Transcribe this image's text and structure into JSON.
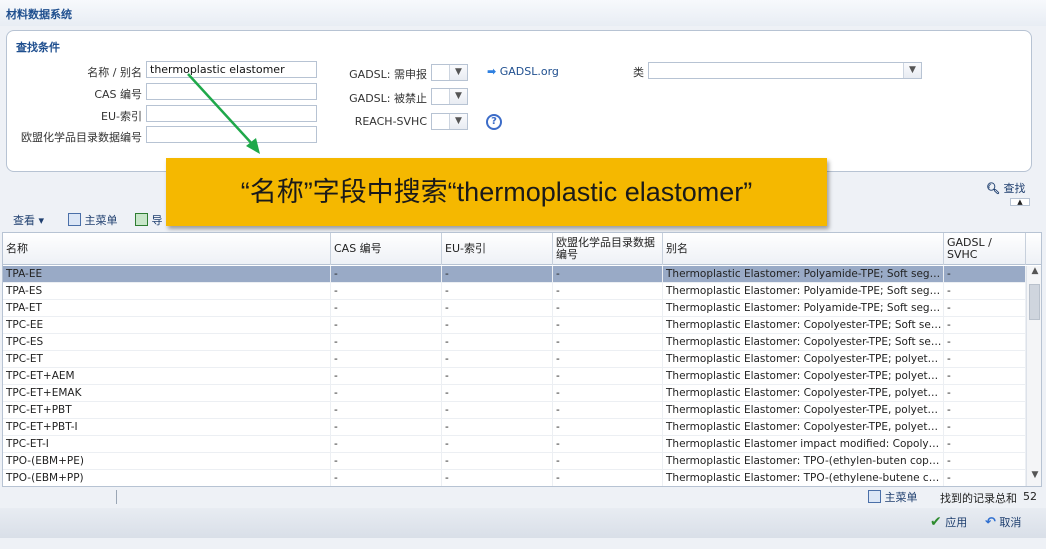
{
  "window": {
    "title": "材料数据系统"
  },
  "search": {
    "header": "查找条件",
    "name_label": "名称 / 别名",
    "name_value": "thermoplastic elastomer",
    "cas_label": "CAS 编号",
    "eu_label": "EU-索引",
    "eci_label": "欧盟化学品目录数据编号",
    "gadsl_declare_label": "GADSL: 需申报",
    "gadsl_forbid_label": "GADSL: 被禁止",
    "reach_label": "REACH-SVHC",
    "gadsl_link": "GADSL.org",
    "class_label": "类",
    "help_icon": "?",
    "find_label": "查找"
  },
  "callout": {
    "text": "“名称”字段中搜索“thermoplastic elastomer”"
  },
  "toolbar": {
    "view_label": "查看 ▾",
    "main_menu_label": "主菜单",
    "export_label": "导"
  },
  "grid": {
    "headers": [
      "名称",
      "CAS 编号",
      "EU-索引",
      "欧盟化学品目录数据编号",
      "别名",
      "GADSL / SVHC"
    ],
    "rows": [
      [
        "TPA-EE",
        "-",
        "-",
        "-",
        "Thermoplastic Elastomer: Polyamide-TPE; Soft segment...",
        "-"
      ],
      [
        "TPA-ES",
        "-",
        "-",
        "-",
        "Thermoplastic Elastomer: Polyamide-TPE; Soft segment...",
        "-"
      ],
      [
        "TPA-ET",
        "-",
        "-",
        "-",
        "Thermoplastic Elastomer: Polyamide-TPE; Soft segment...",
        "-"
      ],
      [
        "TPC-EE",
        "-",
        "-",
        "-",
        "Thermoplastic Elastomer: Copolyester-TPE; Soft segme...",
        "-"
      ],
      [
        "TPC-ES",
        "-",
        "-",
        "-",
        "Thermoplastic Elastomer: Copolyester-TPE; Soft segme...",
        "-"
      ],
      [
        "TPC-ET",
        "-",
        "-",
        "-",
        "Thermoplastic Elastomer: Copolyester-TPE; polyether s...",
        "-"
      ],
      [
        "TPC-ET+AEM",
        "-",
        "-",
        "-",
        "Thermoplastic Elastomer: Copolyester-TPE; polyether s...",
        "-"
      ],
      [
        "TPC-ET+EMAK",
        "-",
        "-",
        "-",
        "Thermoplastic Elastomer: Copolyester-TPE, polyether s...",
        "-"
      ],
      [
        "TPC-ET+PBT",
        "-",
        "-",
        "-",
        "Thermoplastic Elastomer: Copolyester-TPE, polyether s...",
        "-"
      ],
      [
        "TPC-ET+PBT-I",
        "-",
        "-",
        "-",
        "Thermoplastic Elastomer: Copolyester-TPE, polyether s...",
        "-"
      ],
      [
        "TPC-ET-I",
        "-",
        "-",
        "-",
        "Thermoplastic Elastomer impact modified: Copolyester-...",
        "-"
      ],
      [
        "TPO-(EBM+PE)",
        "-",
        "-",
        "-",
        "Thermoplastic Elastomer: TPO-(ethylen-buten copolym...",
        "-"
      ],
      [
        "TPO-(EBM+PP)",
        "-",
        "-",
        "-",
        "Thermoplastic Elastomer: TPO-(ethylene-butene copoly...",
        "-"
      ]
    ]
  },
  "status": {
    "main_menu_label": "主菜单",
    "records_label": "找到的记录总和",
    "records_count": "52"
  },
  "footer": {
    "apply_label": "应用",
    "cancel_label": "取消"
  }
}
